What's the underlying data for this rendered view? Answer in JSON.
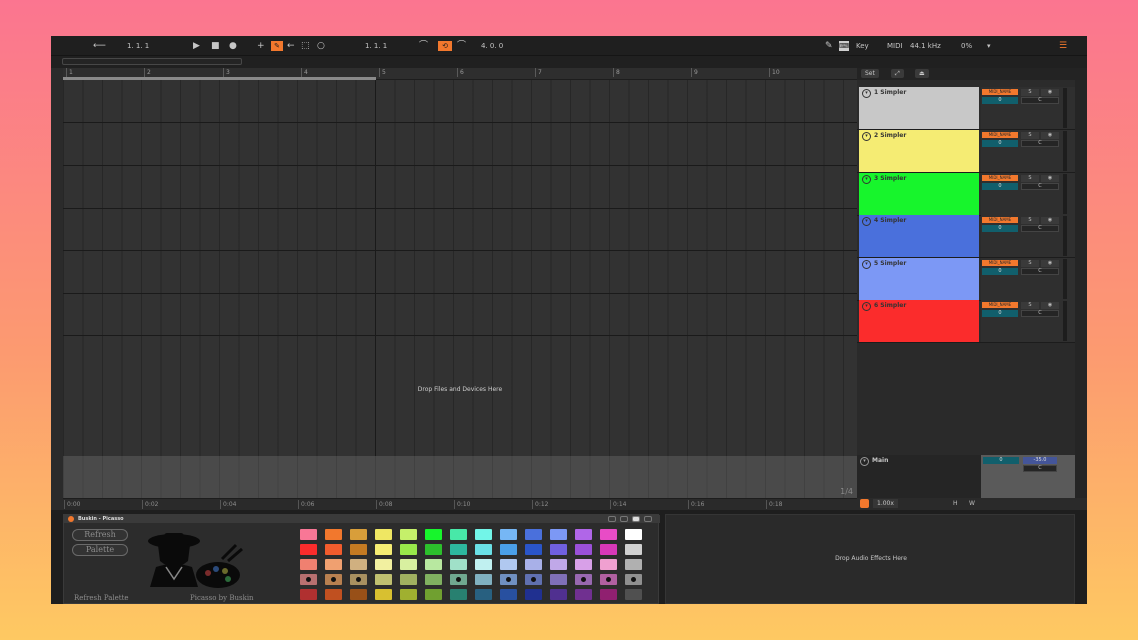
{
  "transport": {
    "position": "1.  1.  1",
    "loop_start": "1.  1.  1",
    "loop_length": "4.  0.  0",
    "key_label": "Key",
    "midi_label": "MIDI",
    "sample_rate": "44.1 kHz",
    "cpu": "0%"
  },
  "ruler": {
    "bars": [
      "1",
      "2",
      "3",
      "4",
      "5",
      "6",
      "7",
      "8",
      "9",
      "10"
    ]
  },
  "timeline": {
    "times": [
      "0:00",
      "0:02",
      "0:04",
      "0:06",
      "0:08",
      "0:10",
      "0:12",
      "0:14",
      "0:16",
      "0:18"
    ],
    "page_indicator": "1/4"
  },
  "arrangement": {
    "drop_text": "Drop Files and Devices Here"
  },
  "header_bar": {
    "set_label": "Set"
  },
  "tracks": [
    {
      "name": "1 Simpler",
      "color": "#c8c8c8",
      "midi": "MIDI_NAME",
      "volume": "0",
      "channel": "C",
      "solo": "S"
    },
    {
      "name": "2 Simpler",
      "color": "#f5ec73",
      "midi": "MIDI_NAME",
      "volume": "0",
      "channel": "C",
      "solo": "S"
    },
    {
      "name": "3 Simpler",
      "color": "#17f52c",
      "midi": "MIDI_NAME",
      "volume": "0",
      "channel": "C",
      "solo": "S"
    },
    {
      "name": "4 Simpler",
      "color": "#4a70dc",
      "midi": "MIDI_NAME",
      "volume": "0",
      "channel": "C",
      "solo": "S"
    },
    {
      "name": "5 Simpler",
      "color": "#7c98f5",
      "midi": "MIDI_NAME",
      "volume": "0",
      "channel": "C",
      "solo": "S"
    },
    {
      "name": "6 Simpler",
      "color": "#fb2c2c",
      "midi": "MIDI_NAME",
      "volume": "0",
      "channel": "C",
      "solo": "S"
    }
  ],
  "main_track": {
    "name": "Main",
    "volume": "0",
    "value": "-35.0",
    "channel": "C"
  },
  "footer": {
    "tempo": "1.00x",
    "h_label": "H",
    "w_label": "W"
  },
  "device": {
    "title": "Buskin - Picasso",
    "refresh_button": "Refresh",
    "palette_button": "Palette",
    "refresh_palette_label": "Refresh Palette",
    "credit": "Picasso by Buskin",
    "fx_drop_text": "Drop Audio Effects Here",
    "swatches": [
      "#f87796",
      "#f2782d",
      "#d89e3a",
      "#efe763",
      "#c5f06a",
      "#17f52c",
      "#48e8a8",
      "#72f5e8",
      "#76b7f5",
      "#4a70dc",
      "#7c98f5",
      "#b066e8",
      "#e84cc6",
      "#ffffff",
      "#fb2c2c",
      "#f25c2d",
      "#c47a22",
      "#f5ec73",
      "#98e84a",
      "#2cc02c",
      "#2db89e",
      "#6ae0e6",
      "#4a9fe8",
      "#2a55c8",
      "#7060e0",
      "#9a50d8",
      "#d838b8",
      "#d0d0d0",
      "#f08070",
      "#f0a070",
      "#d0b080",
      "#f2f0a0",
      "#d8f0a0",
      "#b8e8a0",
      "#a0e0c8",
      "#c0f0f0",
      "#b0c8f0",
      "#a8b0e8",
      "#c0a8e8",
      "#d8a0e8",
      "#f0a0d0",
      "#b0b0b0",
      "#b87070",
      "#b88050",
      "#a89060",
      "#c0c070",
      "#a0b060",
      "#80b060",
      "#70a890",
      "#80b0c0",
      "#7090c0",
      "#6070b0",
      "#8070b8",
      "#9868b0",
      "#b060a0",
      "#909090",
      "#b03030",
      "#c05020",
      "#985018",
      "#d8c030",
      "#a0b030",
      "#70a030",
      "#288070",
      "#286080",
      "#2850a0",
      "#203090",
      "#503090",
      "#703090",
      "#902070",
      "#505050"
    ],
    "swatch_dots": [
      0,
      0,
      0,
      0,
      0,
      0,
      0,
      0,
      0,
      0,
      0,
      0,
      0,
      0,
      0,
      0,
      0,
      0,
      0,
      0,
      0,
      0,
      0,
      0,
      0,
      0,
      0,
      0,
      0,
      0,
      0,
      0,
      0,
      0,
      0,
      0,
      0,
      0,
      0,
      0,
      0,
      0,
      1,
      1,
      1,
      0,
      0,
      0,
      1,
      0,
      1,
      1,
      0,
      1,
      1,
      1,
      0,
      0,
      0,
      0,
      0,
      0,
      0,
      0,
      0,
      0,
      0,
      0,
      0,
      0
    ]
  }
}
